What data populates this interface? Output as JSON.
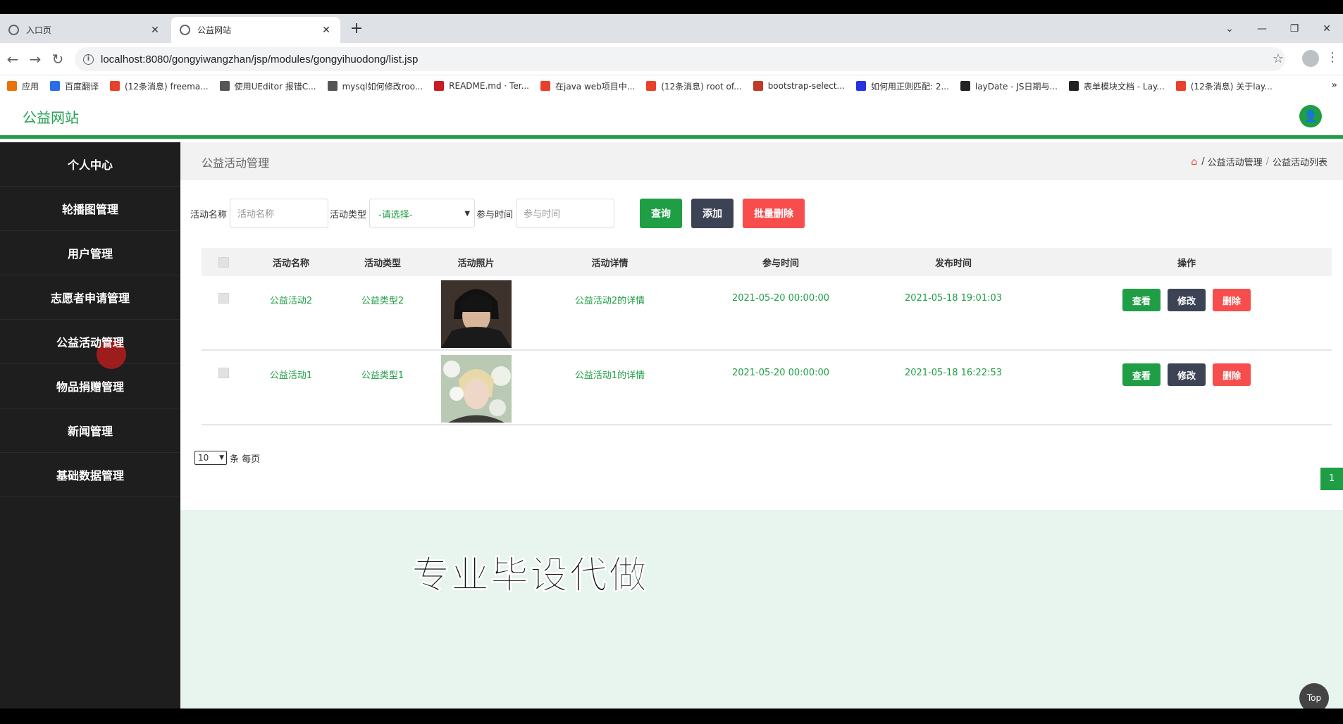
{
  "browser": {
    "tabs": [
      {
        "title": "入口页",
        "active": false
      },
      {
        "title": "公益网站",
        "active": true
      }
    ],
    "new_tab": "+",
    "url": "localhost:8080/gongyiwangzhan/jsp/modules/gongyihuodong/list.jsp",
    "bookmarks": [
      {
        "label": "应用",
        "color": "#e8710a"
      },
      {
        "label": "百度翻译",
        "color": "#2b6de8"
      },
      {
        "label": "(12条消息) freema...",
        "color": "#e8412b"
      },
      {
        "label": "使用UEditor 报错C...",
        "color": "#555555"
      },
      {
        "label": "mysql如何修改roo...",
        "color": "#555555"
      },
      {
        "label": "README.md · Ter...",
        "color": "#c71d23"
      },
      {
        "label": "在java web项目中...",
        "color": "#e8412b"
      },
      {
        "label": "(12条消息) root of...",
        "color": "#e8412b"
      },
      {
        "label": "bootstrap-select...",
        "color": "#c0392b"
      },
      {
        "label": "如何用正则匹配: 2...",
        "color": "#2932e1"
      },
      {
        "label": "layDate - JS日期与...",
        "color": "#222222"
      },
      {
        "label": "表单模块文档 - Lay...",
        "color": "#222222"
      },
      {
        "label": "(12条消息) 关于lay...",
        "color": "#e8412b"
      }
    ],
    "bookmarks_more": "»"
  },
  "site": {
    "title": "公益网站"
  },
  "sidebar": {
    "items": [
      {
        "label": "个人中心"
      },
      {
        "label": "轮播图管理"
      },
      {
        "label": "用户管理"
      },
      {
        "label": "志愿者申请管理"
      },
      {
        "label": "公益活动管理"
      },
      {
        "label": "物品捐赠管理"
      },
      {
        "label": "新闻管理"
      },
      {
        "label": "基础数据管理"
      }
    ]
  },
  "page": {
    "heading": "公益活动管理",
    "breadcrumb": [
      "公益活动管理",
      "公益活动列表"
    ],
    "breadcrumb_sep": "/"
  },
  "search": {
    "name_label": "活动名称",
    "name_placeholder": "活动名称",
    "type_label": "活动类型",
    "type_selected": "-请选择-",
    "time_label": "参与时间",
    "time_placeholder": "参与时间",
    "query_btn": "查询",
    "add_btn": "添加",
    "batch_delete_btn": "批量删除"
  },
  "table": {
    "headers": [
      "活动名称",
      "活动类型",
      "活动照片",
      "活动详情",
      "参与时间",
      "发布时间",
      "操作"
    ],
    "rows": [
      {
        "name": "公益活动2",
        "type": "公益类型2",
        "detail": "公益活动2的详情",
        "join_time": "2021-05-20 00:00:00",
        "publish_time": "2021-05-18 19:01:03"
      },
      {
        "name": "公益活动1",
        "type": "公益类型1",
        "detail": "公益活动1的详情",
        "join_time": "2021-05-20 00:00:00",
        "publish_time": "2021-05-18 16:22:53"
      }
    ],
    "view_btn": "查看",
    "edit_btn": "修改",
    "delete_btn": "删除"
  },
  "pager": {
    "page_size": "10",
    "per_page_label": "条 每页",
    "current_page": "1"
  },
  "overlay": {
    "watermark": "专业毕设代做",
    "top_btn": "Top"
  }
}
